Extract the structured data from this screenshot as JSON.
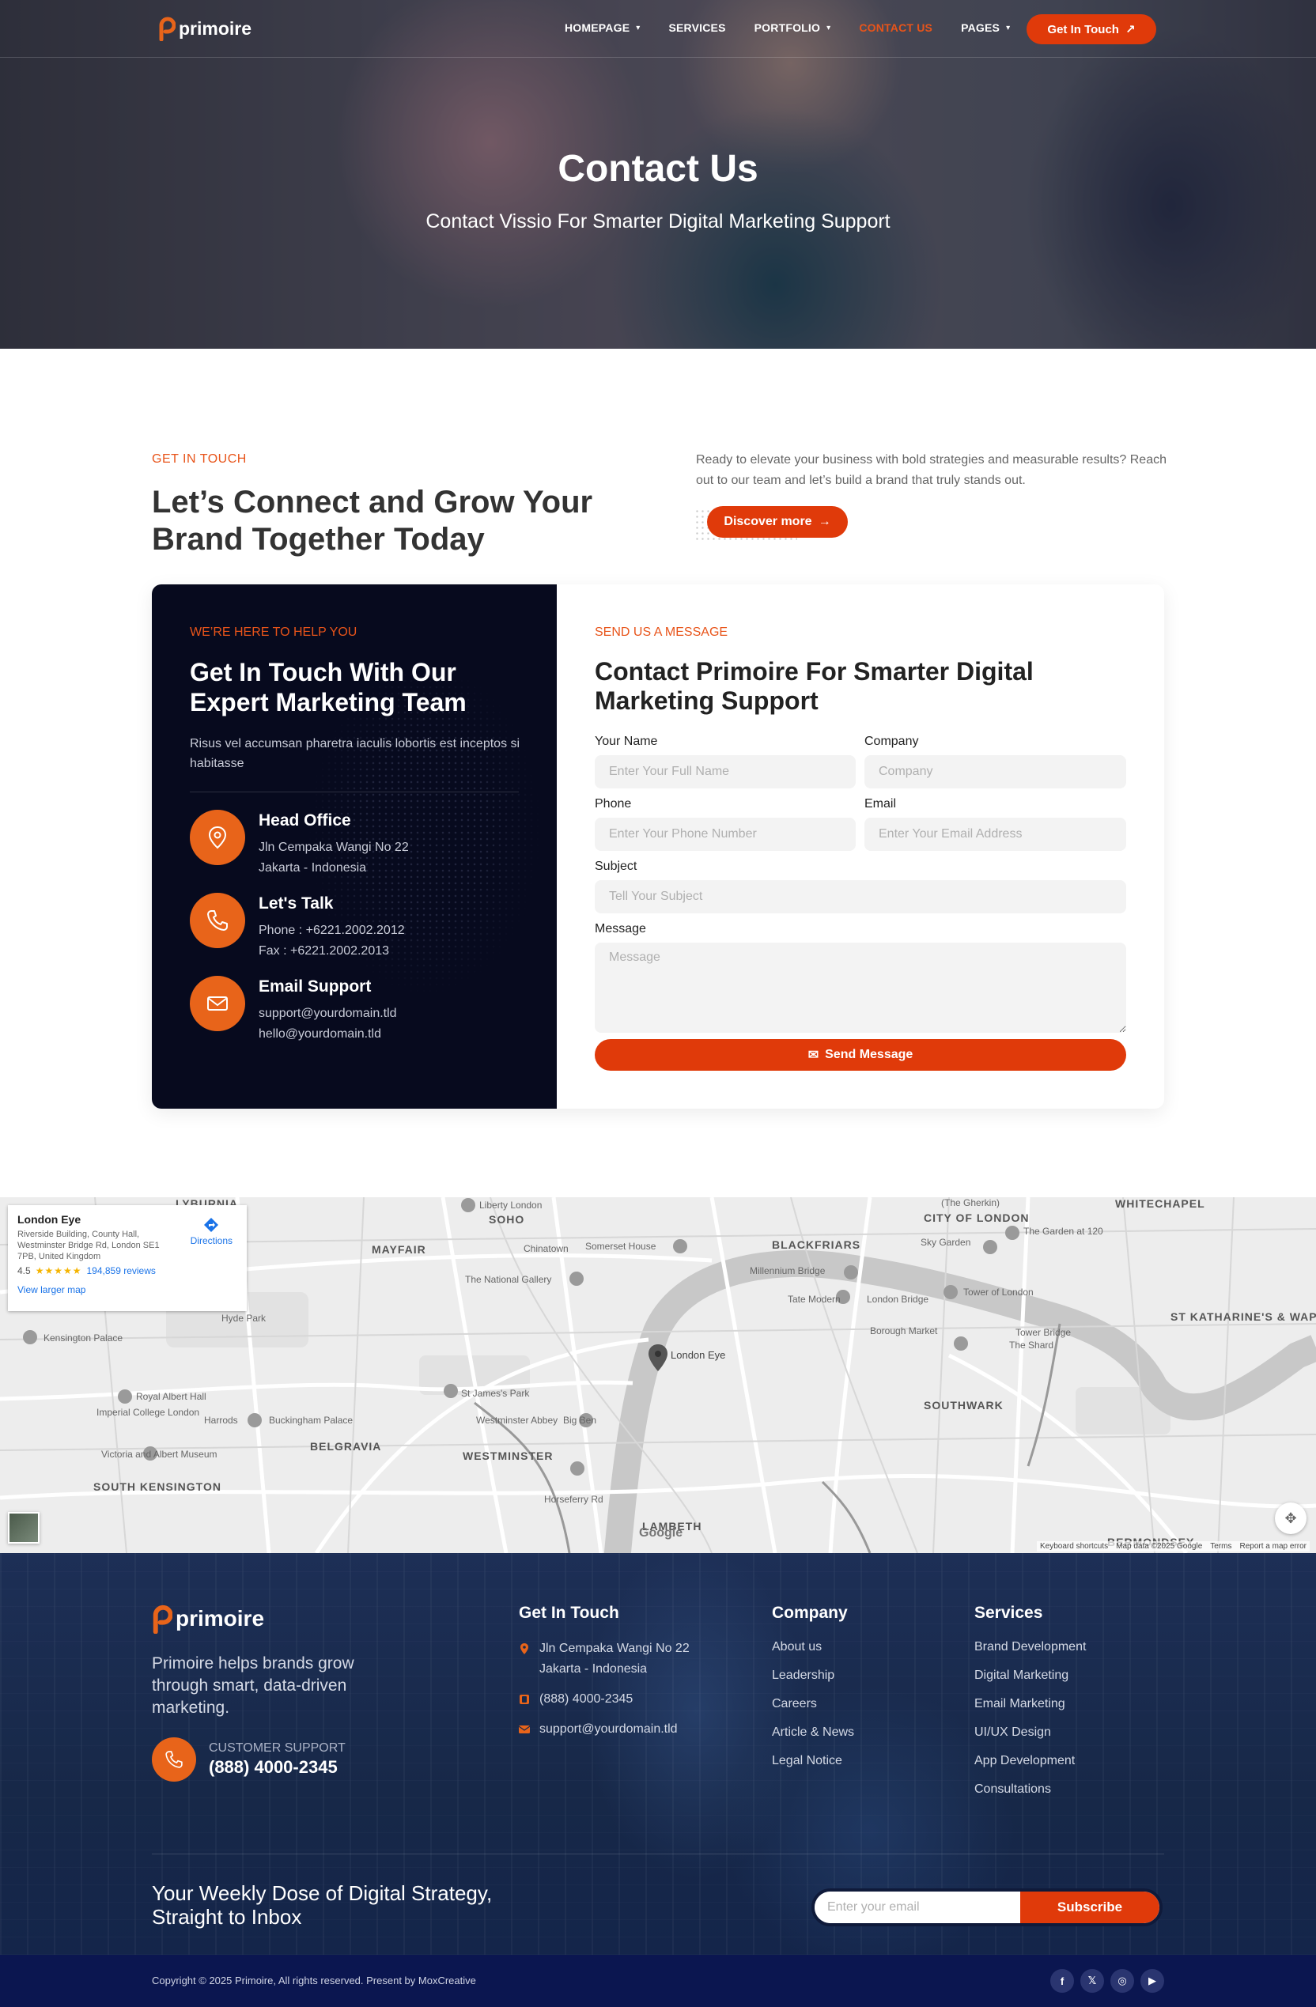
{
  "nav": {
    "logo": "primoire",
    "links": [
      {
        "label": "HOMEPAGE",
        "dropdown": true
      },
      {
        "label": "SERVICES",
        "dropdown": false
      },
      {
        "label": "PORTFOLIO",
        "dropdown": true
      },
      {
        "label": "CONTACT US",
        "dropdown": false,
        "active": true
      },
      {
        "label": "PAGES",
        "dropdown": true
      }
    ],
    "cta": "Get In Touch"
  },
  "hero": {
    "title": "Contact Us",
    "subtitle": "Contact Vissio For Smarter Digital Marketing Support"
  },
  "intro": {
    "eyebrow": "GET IN TOUCH",
    "title": "Let’s Connect and Grow Your Brand Together Today",
    "text": "Ready to elevate your business with bold strategies and measurable results? Reach out to our team and let’s build a brand that truly stands out.",
    "button": "Discover more"
  },
  "contact_panel": {
    "eyebrow": "WE’RE HERE TO HELP YOU",
    "title": "Get In Touch With Our Expert Marketing Team",
    "desc": "Risus vel accumsan pharetra iaculis lobortis est inceptos si habitasse",
    "items": [
      {
        "title": "Head Office",
        "line1": "Jln Cempaka Wangi No 22",
        "line2": "Jakarta - Indonesia"
      },
      {
        "title": "Let's Talk",
        "line1": "Phone : +6221.2002.2012",
        "line2": "Fax : +6221.2002.2013"
      },
      {
        "title": "Email Support",
        "line1": "support@yourdomain.tld",
        "line2": "hello@yourdomain.tld"
      }
    ]
  },
  "form": {
    "eyebrow": "SEND US A MESSAGE",
    "title": "Contact Primoire For Smarter Digital Marketing Support",
    "name_label": "Your Name",
    "name_placeholder": "Enter Your Full Name",
    "company_label": "Company",
    "company_placeholder": "Company",
    "phone_label": "Phone",
    "phone_placeholder": "Enter Your Phone Number",
    "email_label": "Email",
    "email_placeholder": "Enter Your Email Address",
    "subject_label": "Subject",
    "subject_placeholder": "Tell Your Subject",
    "message_label": "Message",
    "message_placeholder": "Message",
    "submit": "Send Message"
  },
  "map": {
    "place_name": "London Eye",
    "place_address": "Riverside Building, County Hall, Westminster Bridge Rd, London SE1 7PB, United Kingdom",
    "rating": "4.5",
    "stars": "★★★★★",
    "reviews": "194,859 reviews",
    "directions": "Directions",
    "larger_map": "View larger map",
    "pin_label": "London Eye",
    "google": "Google",
    "footer": [
      "Keyboard shortcuts",
      "Map data ©2025 Google",
      "Terms",
      "Report a map error"
    ],
    "areas": [
      "MAYFAIR",
      "SOHO",
      "BLACKFRIARS",
      "CITY OF LONDON",
      "WHITECHAPEL",
      "ST KATHARINE'S & WAPPING",
      "BELGRAVIA",
      "WESTMINSTER",
      "LAMBETH",
      "SOUTHWARK",
      "SOUTH KENSINGTON",
      "BERMONDSEY",
      "LYBURNIA"
    ],
    "places": [
      "Liberty London",
      "Somerset House",
      "The National Gallery",
      "Hyde Park",
      "Kensington Palace",
      "Royal Albert Hall",
      "Harrods",
      "Buckingham Palace",
      "St James's Park",
      "Big Ben",
      "Westminster Abbey",
      "Imperial College London",
      "Victoria and Albert Museum",
      "Millennium Bridge",
      "Tate Modern",
      "London Bridge",
      "Tower of London",
      "Tower Bridge",
      "The Shard",
      "Borough Market",
      "Sky Garden",
      "The Garden at 120",
      "(The Gherkin)",
      "Horseferry Rd",
      "Chinatown"
    ]
  },
  "footer": {
    "logo": "primoire",
    "about": "Primoire helps brands grow through smart, data-driven marketing.",
    "support_label": "CUSTOMER SUPPORT",
    "support_number": "(888) 4000-2345",
    "git_title": "Get In Touch",
    "git_address1": "Jln Cempaka Wangi No 22",
    "git_address2": "Jakarta - Indonesia",
    "git_phone": "(888) 4000-2345",
    "git_email": "support@yourdomain.tld",
    "company_title": "Company",
    "company_links": [
      "About us",
      "Leadership",
      "Careers",
      "Article & News",
      "Legal Notice"
    ],
    "services_title": "Services",
    "services_links": [
      "Brand Development",
      "Digital Marketing",
      "Email Marketing",
      "UI/UX Design",
      "App Development",
      "Consultations"
    ],
    "newsletter": "Your Weekly Dose of Digital Strategy, Straight to Inbox",
    "email_placeholder": "Enter your email",
    "subscribe": "Subscribe",
    "copyright": "Copyright © 2025 Primoire, All rights reserved. Present by MoxCreative",
    "socials": [
      {
        "icon": "facebook-icon",
        "glyph": "f"
      },
      {
        "icon": "x-icon",
        "glyph": "𝕏"
      },
      {
        "icon": "instagram-icon",
        "glyph": "◎"
      },
      {
        "icon": "youtube-icon",
        "glyph": "▶"
      }
    ]
  },
  "colors": {
    "accent": "#e03a0a",
    "orange": "#e8641a",
    "dark_panel": "#070a1e",
    "footer": "#172848",
    "bottom_bar": "#0b1650"
  }
}
